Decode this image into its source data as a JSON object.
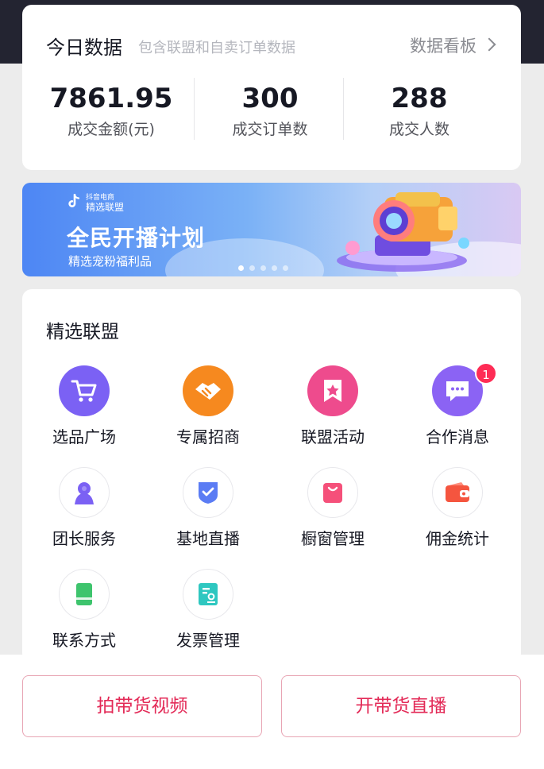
{
  "stats": {
    "title": "今日数据",
    "subtitle": "包含联盟和自卖订单数据",
    "dashboard_link": "数据看板",
    "metrics": [
      {
        "value": "7861.95",
        "label": "成交金额(元)"
      },
      {
        "value": "300",
        "label": "成交订单数"
      },
      {
        "value": "288",
        "label": "成交人数"
      }
    ]
  },
  "banner": {
    "brand": "抖音电商",
    "logo_text": "精选联盟",
    "title": "全民开播计划",
    "subtitle": "精选宠粉福利品",
    "dots": 5,
    "active_dot": 0
  },
  "features": {
    "title": "精选联盟",
    "items": [
      {
        "label": "选品广场",
        "icon": "cart-icon",
        "color": "#7b61f4"
      },
      {
        "label": "专属招商",
        "icon": "handshake-icon",
        "color": "#f6891f"
      },
      {
        "label": "联盟活动",
        "icon": "bookmark-star-icon",
        "color": "#ee4b8d"
      },
      {
        "label": "合作消息",
        "icon": "chat-icon",
        "color": "#8b63f4",
        "badge": "1"
      },
      {
        "label": "团长服务",
        "icon": "person-icon",
        "color": "#7b61f4"
      },
      {
        "label": "基地直播",
        "icon": "shield-check-icon",
        "color": "#5b7cf4"
      },
      {
        "label": "橱窗管理",
        "icon": "shopping-bag-icon",
        "color": "#f5507a"
      },
      {
        "label": "佣金统计",
        "icon": "wallet-icon",
        "color": "#f5553f"
      },
      {
        "label": "联系方式",
        "icon": "phone-icon",
        "color": "#3ec46d"
      },
      {
        "label": "发票管理",
        "icon": "invoice-icon",
        "color": "#2ec7c0"
      }
    ]
  },
  "actions": {
    "video_label": "拍带货视频",
    "live_label": "开带货直播"
  }
}
